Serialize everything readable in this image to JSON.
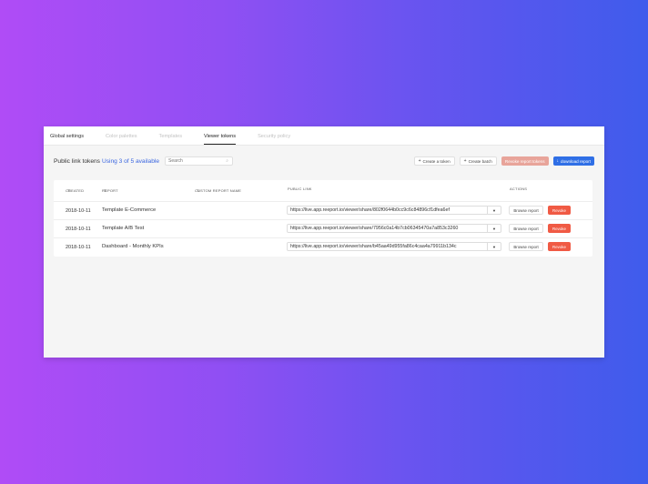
{
  "tabs": [
    {
      "label": "Global settings"
    },
    {
      "label": "Color palettes"
    },
    {
      "label": "Templates"
    },
    {
      "label": "Viewer tokens"
    },
    {
      "label": "Security policy"
    }
  ],
  "toolbar": {
    "title": "Public link tokens",
    "usage": "Using 3 of 5 available",
    "search_placeholder": "Search",
    "create_token": "Create a token",
    "create_batch": "Create batch",
    "revoke_all": "Revoke report tokens",
    "download": "download report"
  },
  "table": {
    "headers": {
      "created": "CREATED",
      "report": "REPORT",
      "custom_name": "CUSTOM REPORT NAME",
      "public_link": "PUBLIC LINK",
      "actions": "ACTIONS"
    },
    "rows": [
      {
        "created": "2018-10-11",
        "report": "Template E-Commerce",
        "link": "https://live.app.reeport.io/viewer/share/802f0644b0cc9c6c84896cf1dfea6ef",
        "browse": "Browse report",
        "revoke": "Revoke"
      },
      {
        "created": "2018-10-11",
        "report": "Template A/B Test",
        "link": "https://live.app.reeport.io/viewer/share/7956c0a14b7cb06345470a7a853c3260",
        "browse": "Browse report",
        "revoke": "Revoke"
      },
      {
        "created": "2018-10-11",
        "report": "Dashboard - Monthly KPIs",
        "link": "https://live.app.reeport.io/viewer/share/b45aa49d955fa86c4caa4a79911b134c",
        "browse": "Browse report",
        "revoke": "Revoke"
      }
    ]
  },
  "colors": {
    "accent": "#2f6fe6",
    "danger": "#f05a44",
    "usage_link": "#3a66e0"
  }
}
